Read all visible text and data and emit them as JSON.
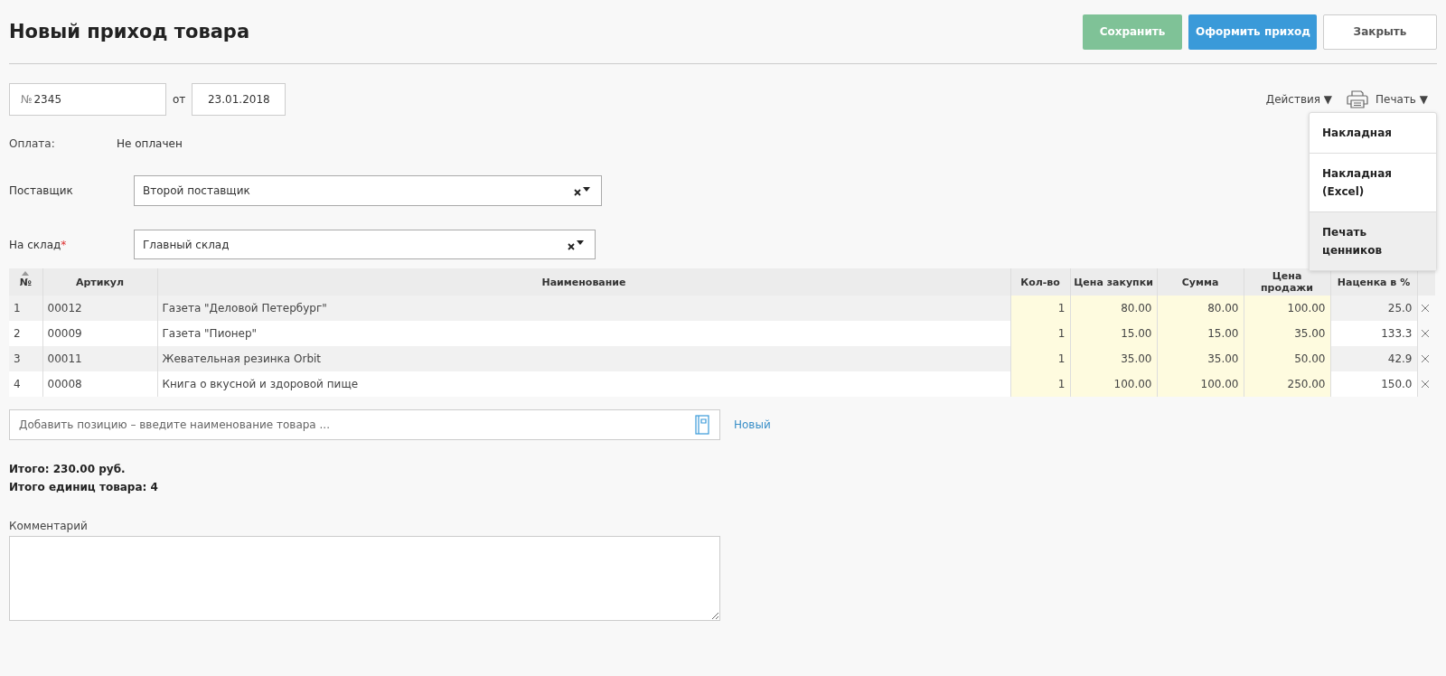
{
  "title": "Новый приход товара",
  "buttons": [
    {
      "label": "Сохранить",
      "kind": "success"
    },
    {
      "label": "Оформить приход",
      "kind": "primary"
    },
    {
      "label": "Закрыть",
      "kind": "default"
    }
  ],
  "number": {
    "prefix": "№",
    "value": "2345"
  },
  "date_label": "от",
  "date": "23.01.2018",
  "actions": {
    "label": "Действия",
    "caret": "▼"
  },
  "print": {
    "label": "Печать",
    "caret": "▼",
    "menu": [
      {
        "label": "Накладная",
        "selected": false
      },
      {
        "label": "Накладная (Excel)",
        "selected": false
      },
      {
        "label": "Печать ценников",
        "selected": true
      }
    ]
  },
  "payment": {
    "label": "Оплата:",
    "value": "Не оплачен"
  },
  "supplier": {
    "label": "Поставщик",
    "value": "Второй поставщик"
  },
  "warehouse": {
    "label": "На склад",
    "required_mark": "*",
    "value": "Главный склад"
  },
  "table": {
    "columns": [
      {
        "label": "№",
        "editable": false
      },
      {
        "label": "Артикул",
        "editable": false
      },
      {
        "label": "Наименование",
        "editable": false
      },
      {
        "label": "Кол-во",
        "editable": true
      },
      {
        "label": "Цена закупки",
        "editable": true
      },
      {
        "label": "Сумма",
        "editable": true
      },
      {
        "label": "Цена продажи",
        "editable": true
      },
      {
        "label": "Наценка в %",
        "editable": false
      }
    ],
    "rows": [
      [
        "1",
        "00012",
        "Газета \"Деловой Петербург\"",
        "1",
        "80.00",
        "80.00",
        "100.00",
        "25.0"
      ],
      [
        "2",
        "00009",
        "Газета \"Пионер\"",
        "1",
        "15.00",
        "15.00",
        "35.00",
        "133.3"
      ],
      [
        "3",
        "00011",
        "Жевательная резинка Orbit",
        "1",
        "35.00",
        "35.00",
        "50.00",
        "42.9"
      ],
      [
        "4",
        "00008",
        "Книга о вкусной и здоровой пище",
        "1",
        "100.00",
        "100.00",
        "250.00",
        "150.0"
      ]
    ]
  },
  "add_item": {
    "placeholder": "Добавить позицию – введите наименование товара ...",
    "new_link": "Новый"
  },
  "totals": [
    "Итого: 230.00 руб.",
    "Итого единиц товара: 4"
  ],
  "comment": {
    "label": "Комментарий"
  }
}
